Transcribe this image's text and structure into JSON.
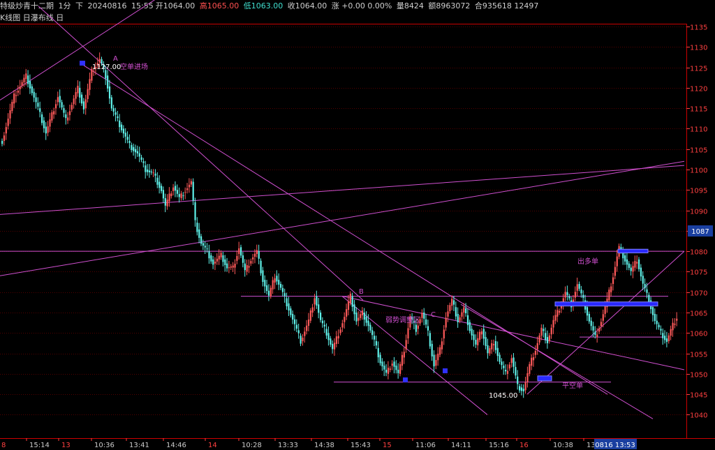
{
  "header": {
    "instrument": "特级炒青十二期",
    "period": "1分",
    "direction": "下",
    "date": "20240816",
    "time": "15:55",
    "open": "开1064.00",
    "high": "高1065.00",
    "low": "低1063.00",
    "close": "收1064.00",
    "change": "涨 +0.00 0.00%",
    "volume": "量8424",
    "amount": "额8963072",
    "position": "合935618 12497"
  },
  "subbar": {
    "chart_type": "K线图",
    "layout": "日瀑布线",
    "box": "日"
  },
  "price_badge": "1087",
  "cursor_time": "0816 13:53",
  "annotations": {
    "A": "A",
    "A_price": "1127.00",
    "A_note": "空单进场",
    "B": "B",
    "C": "C",
    "adjust_zone": "弱势调整区",
    "low_price": "1045.00",
    "close_short": "平空单",
    "go_long": "出多单"
  },
  "colors": {
    "up": "#ff5a5a",
    "down": "#5ff0e8",
    "line": "#d050d0",
    "grid": "#550000",
    "axis": "#ff4040"
  },
  "chart_data": {
    "type": "candlestick",
    "title": "特级炒青十二期 1分",
    "ylim": [
      1036,
      1136
    ],
    "y_ticks": [
      1135,
      1130,
      1125,
      1120,
      1115,
      1110,
      1105,
      1100,
      1095,
      1090,
      1085,
      1080,
      1075,
      1070,
      1065,
      1060,
      1055,
      1050,
      1045,
      1040
    ],
    "x_tick_labels": [
      "8",
      "15:14",
      "13",
      "10:36",
      "13:41",
      "14:46",
      "14",
      "10:28",
      "13:33",
      "14:38",
      "15:43",
      "15",
      "11:06",
      "14:11",
      "15:16",
      "16",
      "10:38",
      "13:4"
    ],
    "date_ticks": [
      "8",
      "13",
      "14",
      "15",
      "16"
    ],
    "path": [
      [
        0,
        1107
      ],
      [
        6,
        1118
      ],
      [
        12,
        1123
      ],
      [
        18,
        1115
      ],
      [
        22,
        1109
      ],
      [
        28,
        1118
      ],
      [
        32,
        1112
      ],
      [
        38,
        1120
      ],
      [
        41,
        1115
      ],
      [
        45,
        1124
      ],
      [
        49,
        1127
      ],
      [
        52,
        1123
      ],
      [
        55,
        1115
      ],
      [
        60,
        1110
      ],
      [
        64,
        1106
      ],
      [
        68,
        1104
      ],
      [
        72,
        1100
      ],
      [
        76,
        1099
      ],
      [
        80,
        1095
      ],
      [
        82,
        1091
      ],
      [
        86,
        1096
      ],
      [
        89,
        1093
      ],
      [
        92,
        1095
      ],
      [
        95,
        1097
      ],
      [
        97,
        1087
      ],
      [
        100,
        1082
      ],
      [
        103,
        1080
      ],
      [
        106,
        1077
      ],
      [
        110,
        1079
      ],
      [
        113,
        1076
      ],
      [
        116,
        1076
      ],
      [
        119,
        1081
      ],
      [
        122,
        1075
      ],
      [
        125,
        1078
      ],
      [
        128,
        1080
      ],
      [
        131,
        1073
      ],
      [
        134,
        1069
      ],
      [
        137,
        1074
      ],
      [
        140,
        1071
      ],
      [
        144,
        1066
      ],
      [
        147,
        1062
      ],
      [
        150,
        1058
      ],
      [
        154,
        1063
      ],
      [
        157,
        1069
      ],
      [
        160,
        1063
      ],
      [
        163,
        1060
      ],
      [
        166,
        1056
      ],
      [
        169,
        1060
      ],
      [
        172,
        1064
      ],
      [
        175,
        1069
      ],
      [
        178,
        1063
      ],
      [
        181,
        1065
      ],
      [
        184,
        1062
      ],
      [
        187,
        1058
      ],
      [
        190,
        1053
      ],
      [
        193,
        1050
      ],
      [
        196,
        1053
      ],
      [
        199,
        1050
      ],
      [
        202,
        1056
      ],
      [
        205,
        1064
      ],
      [
        208,
        1061
      ],
      [
        211,
        1065
      ],
      [
        214,
        1060
      ],
      [
        217,
        1052
      ],
      [
        220,
        1056
      ],
      [
        223,
        1064
      ],
      [
        226,
        1068
      ],
      [
        229,
        1063
      ],
      [
        232,
        1066
      ],
      [
        235,
        1061
      ],
      [
        238,
        1057
      ],
      [
        241,
        1061
      ],
      [
        244,
        1055
      ],
      [
        247,
        1058
      ],
      [
        250,
        1053
      ],
      [
        253,
        1050
      ],
      [
        256,
        1054
      ],
      [
        259,
        1047
      ],
      [
        262,
        1046
      ],
      [
        265,
        1052
      ],
      [
        268,
        1056
      ],
      [
        271,
        1061
      ],
      [
        274,
        1058
      ],
      [
        277,
        1063
      ],
      [
        280,
        1066
      ],
      [
        283,
        1070
      ],
      [
        286,
        1067
      ],
      [
        289,
        1072
      ],
      [
        292,
        1068
      ],
      [
        295,
        1063
      ],
      [
        298,
        1059
      ],
      [
        301,
        1063
      ],
      [
        304,
        1068
      ],
      [
        307,
        1074
      ],
      [
        310,
        1081
      ],
      [
        313,
        1078
      ],
      [
        316,
        1075
      ],
      [
        319,
        1078
      ],
      [
        322,
        1072
      ],
      [
        325,
        1068
      ],
      [
        328,
        1063
      ],
      [
        331,
        1060
      ],
      [
        334,
        1058
      ],
      [
        337,
        1062
      ],
      [
        339,
        1064
      ]
    ],
    "reference_lines": [
      [
        0,
        1117,
        280,
        1148
      ],
      [
        0,
        1089,
        980,
        1101
      ],
      [
        0,
        1074,
        980,
        1102
      ],
      [
        0,
        1080,
        980,
        1080
      ],
      [
        345,
        1069,
        957,
        1069
      ],
      [
        478,
        1048,
        875,
        1048
      ],
      [
        830,
        1059,
        950,
        1059
      ],
      [
        490,
        1069,
        698,
        1040
      ],
      [
        490,
        1069,
        980,
        1051
      ],
      [
        660,
        1067,
        935,
        1039
      ],
      [
        55,
        1140,
        520,
        1068
      ],
      [
        115,
        1126,
        870,
        1045
      ],
      [
        755,
        1045,
        980,
        1080
      ]
    ],
    "boxes": [
      [
        795,
        1067.6,
        942,
        1066.6
      ],
      [
        885,
        1080.5,
        928,
        1079.6
      ],
      [
        770,
        1049.5,
        790,
        1048.3
      ]
    ]
  }
}
